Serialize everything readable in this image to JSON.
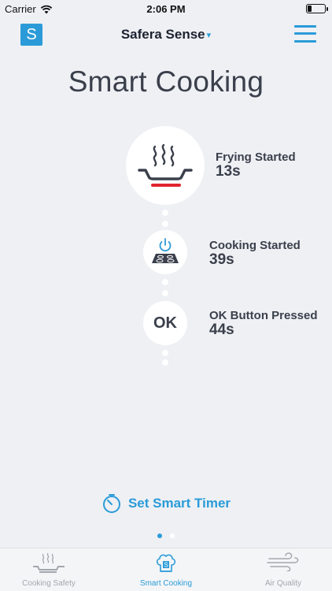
{
  "status_bar": {
    "carrier": "Carrier",
    "time": "2:06 PM",
    "battery_level": 0.25
  },
  "nav": {
    "logo_letter": "S",
    "device_name": "Safera Sense",
    "device_caret": "▾"
  },
  "page_title": "Smart Cooking",
  "events": [
    {
      "label": "Frying Started",
      "time": "13s",
      "icon": "frying-pan-icon"
    },
    {
      "label": "Cooking Started",
      "time": "39s",
      "icon": "stove-power-icon"
    },
    {
      "label": "OK Button Pressed",
      "time": "44s",
      "icon_text": "OK"
    }
  ],
  "timer": {
    "label": "Set Smart Timer",
    "icon": "timer-icon"
  },
  "pagination": {
    "current": 1,
    "total": 2
  },
  "tabs": [
    {
      "label": "Cooking Safety",
      "icon": "steaming-pan-icon",
      "active": false
    },
    {
      "label": "Smart Cooking",
      "icon": "chef-hat-icon",
      "active": true
    },
    {
      "label": "Air Quality",
      "icon": "wind-icon",
      "active": false
    }
  ],
  "colors": {
    "accent": "#2a9bd8",
    "heat": "#e0242f",
    "background": "#eef0f4",
    "text": "#3a3f4b"
  }
}
